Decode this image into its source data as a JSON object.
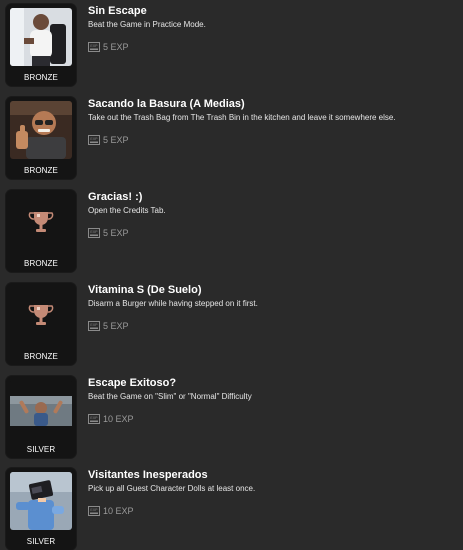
{
  "achievements": [
    {
      "title": "Sin Escape",
      "description": "Beat the Game in Practice Mode.",
      "exp": "5 EXP",
      "tier": "BRONZE",
      "image": "person-chair-photo"
    },
    {
      "title": "Sacando la Basura (A Medias)",
      "description": "Take out the Trash Bag from The Trash Bin in the kitchen and leave it somewhere else.",
      "exp": "5 EXP",
      "tier": "BRONZE",
      "image": "thumbs-up-photo"
    },
    {
      "title": "Gracias! :)",
      "description": "Open the Credits Tab.",
      "exp": "5 EXP",
      "tier": "BRONZE",
      "image": "trophy-icon"
    },
    {
      "title": "Vitamina S (De Suelo)",
      "description": "Disarm a Burger while having stepped on it first.",
      "exp": "5 EXP",
      "tier": "BRONZE",
      "image": "trophy-icon"
    },
    {
      "title": "Escape Exitoso?",
      "description": "Beat the Game on \"Slim\" or \"Normal\" Difficulty",
      "exp": "10 EXP",
      "tier": "SILVER",
      "image": "arms-raised-photo"
    },
    {
      "title": "Visitantes Inesperados",
      "description": "Pick up all Guest Character Dolls at least once.",
      "exp": "10 EXP",
      "tier": "SILVER",
      "image": "doll-figure-photo"
    }
  ],
  "exp_icon_text": "EXP",
  "colors": {
    "background": "#2a2a2a",
    "card": "#141414",
    "exp_text": "#9a9a9a",
    "trophy": "#c48a76"
  }
}
